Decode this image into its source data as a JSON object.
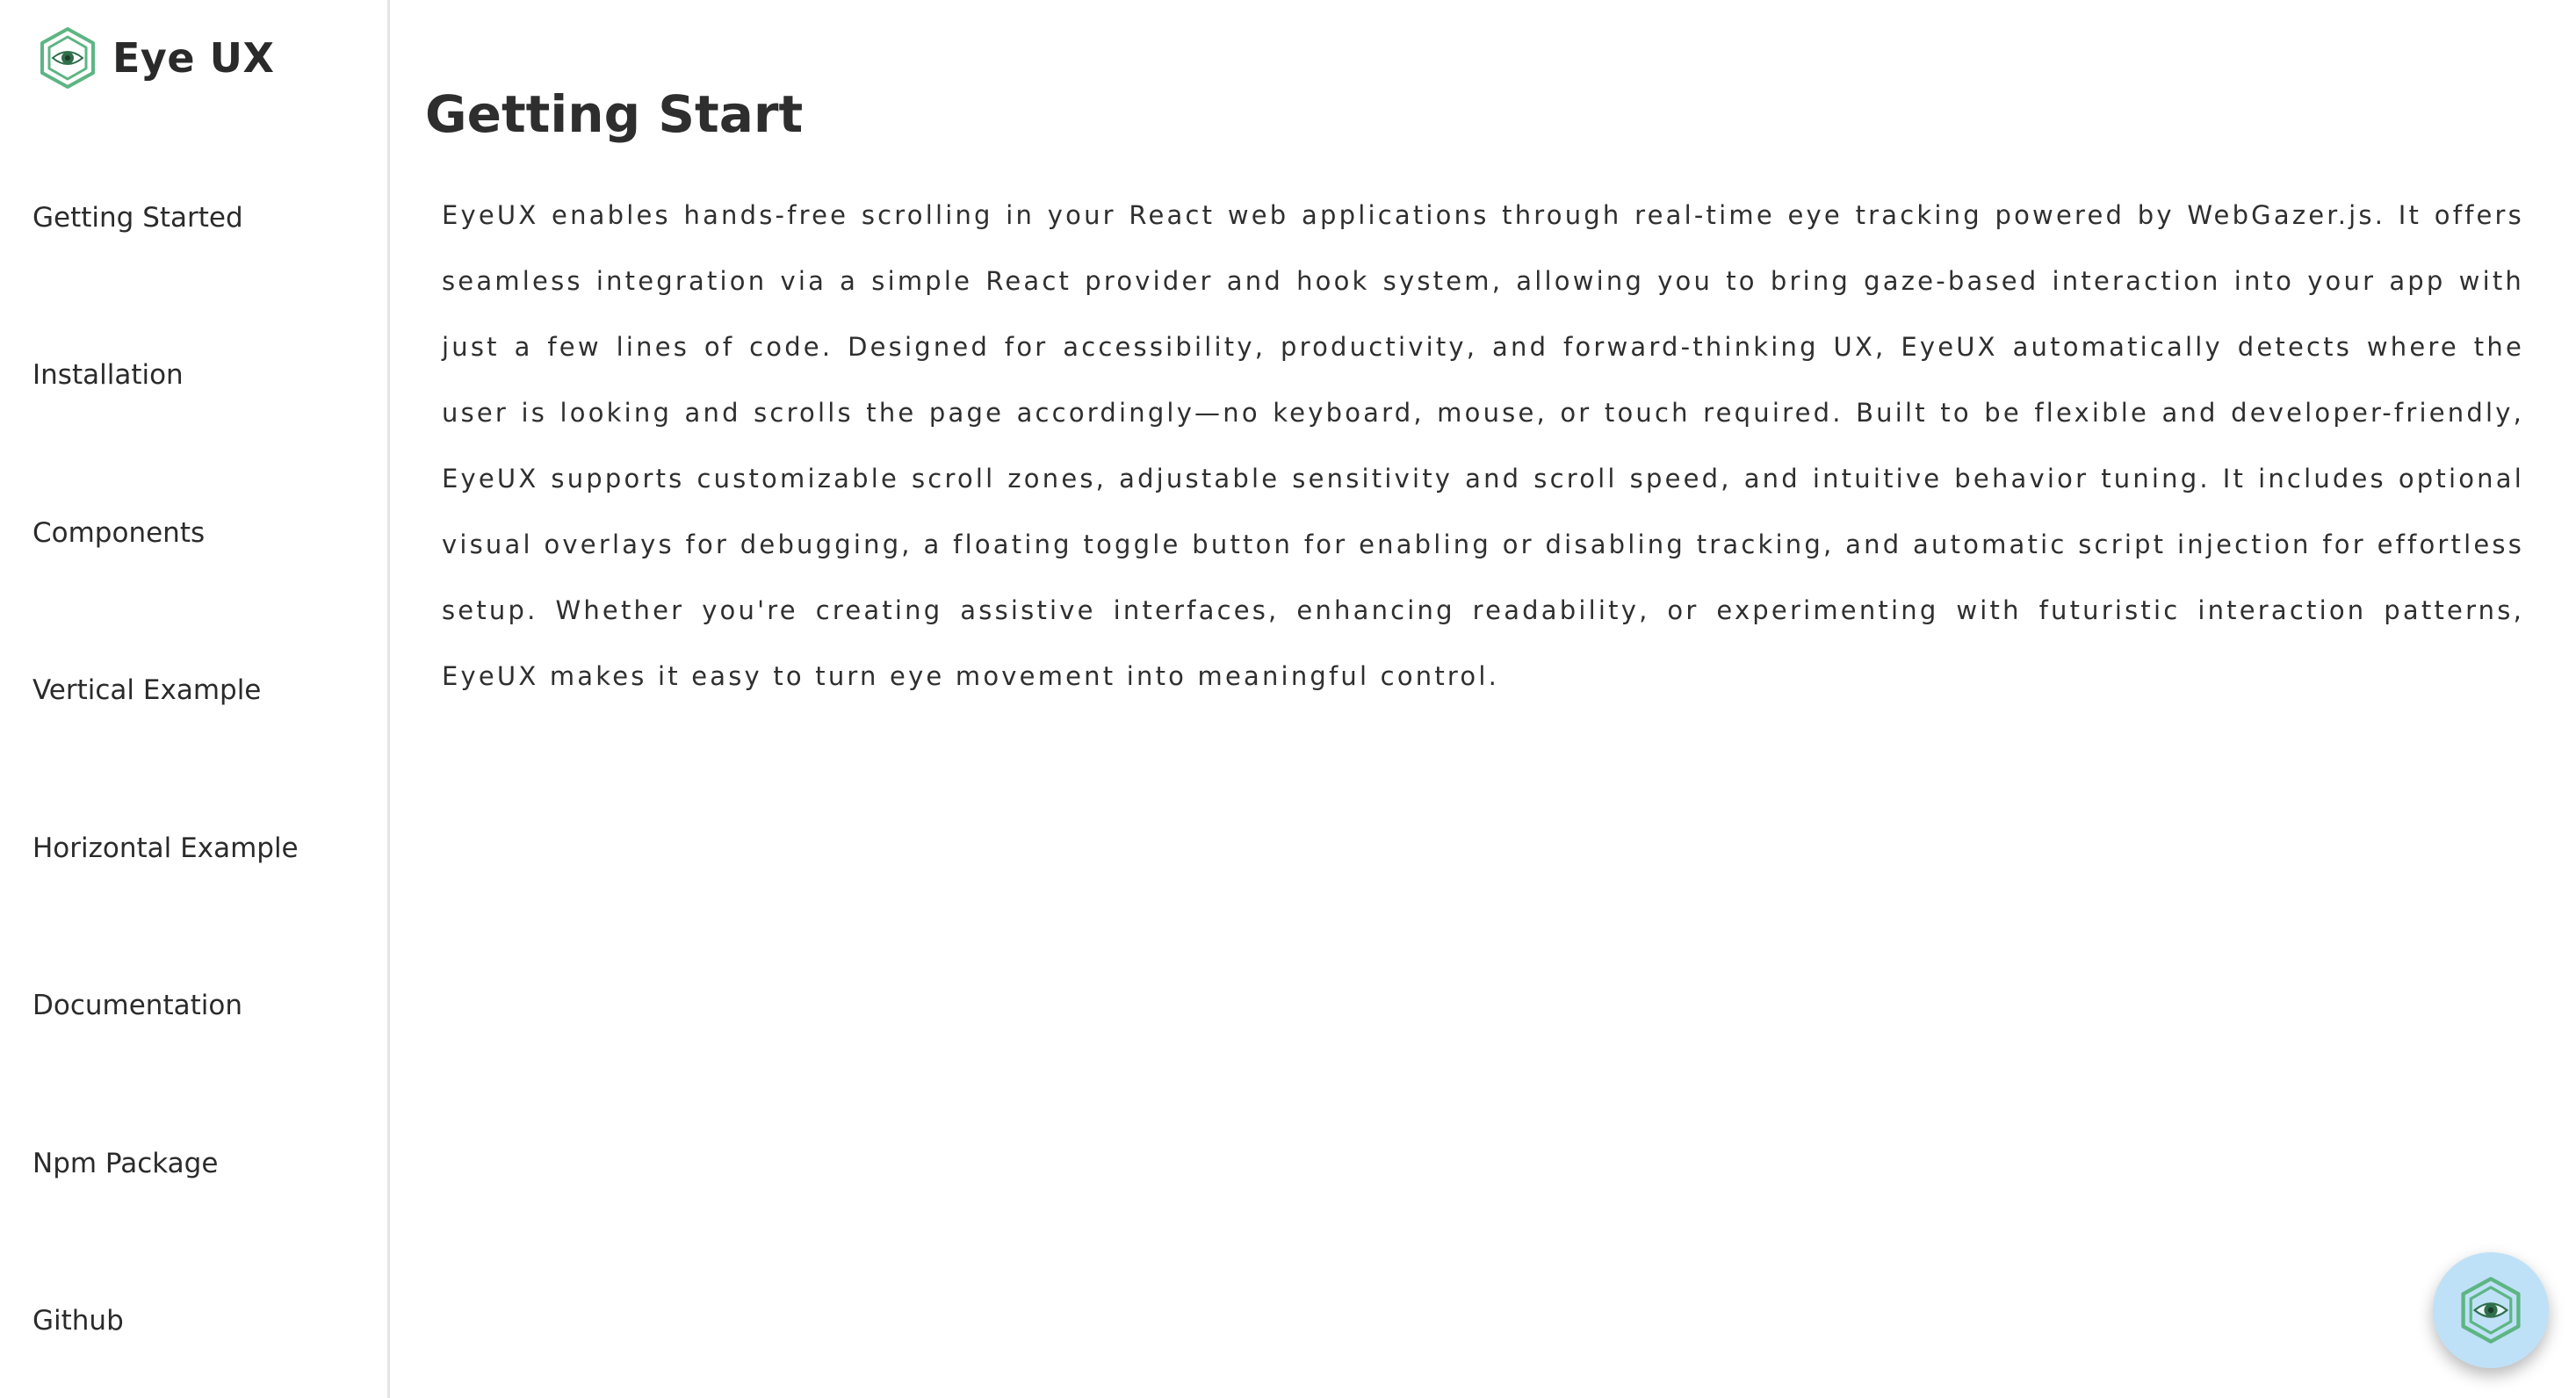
{
  "brand": {
    "name": "Eye UX",
    "logo_icon": "eye-hexagon-icon",
    "accent_color": "#5db583"
  },
  "sidebar": {
    "items": [
      {
        "label": "Getting Started"
      },
      {
        "label": "Installation"
      },
      {
        "label": "Components"
      },
      {
        "label": "Vertical Example"
      },
      {
        "label": "Horizontal Example"
      },
      {
        "label": "Documentation"
      },
      {
        "label": "Npm Package"
      },
      {
        "label": "Github"
      }
    ]
  },
  "main": {
    "title": "Getting Start",
    "intro": "EyeUX enables hands-free scrolling in your React web applications through real-time eye tracking powered by WebGazer.js. It offers seamless integration via a simple React provider and hook system, allowing you to bring gaze-based interaction into your app with just a few lines of code. Designed for accessibility, productivity, and forward-thinking UX, EyeUX automatically detects where the user is looking and scrolls the page accordingly—no keyboard, mouse, or touch required. Built to be flexible and developer-friendly, EyeUX supports customizable scroll zones, adjustable sensitivity and scroll speed, and intuitive behavior tuning. It includes optional visual overlays for debugging, a floating toggle button for enabling or disabling tracking, and automatic script injection for effortless setup. Whether you're creating assistive interfaces, enhancing readability, or experimenting with futuristic interaction patterns, EyeUX makes it easy to turn eye movement into meaningful control."
  },
  "fab": {
    "icon": "eye-hexagon-icon",
    "background_color": "#bfe1f8"
  }
}
